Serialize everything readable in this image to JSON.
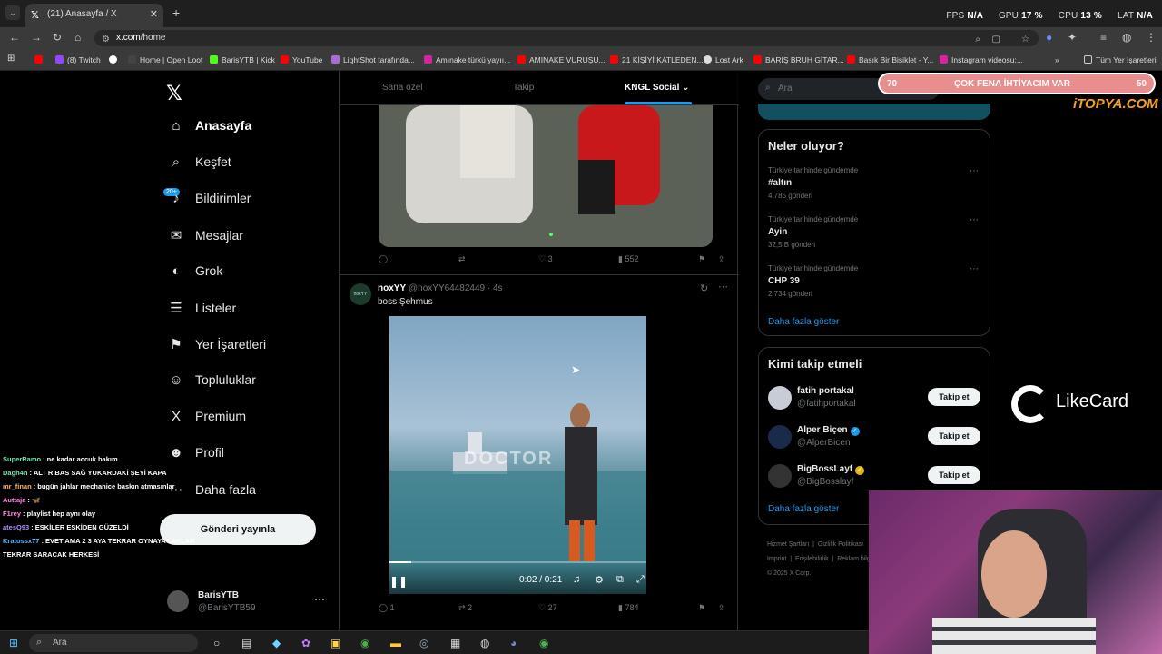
{
  "browser": {
    "tab_title": "(21) Anasayfa / X",
    "url_host": "x.com",
    "url_path": "/home",
    "bookmarks": [
      {
        "label": "(8) Twitch",
        "color": "#9146ff"
      },
      {
        "label": "Home | Open Loot",
        "color": "#444"
      },
      {
        "label": "BarisYTB | Kick",
        "color": "#53fc18"
      },
      {
        "label": "YouTube",
        "color": "#ff0000"
      },
      {
        "label": "LightShot tarafında...",
        "color": "#a86cd6"
      },
      {
        "label": "Amınake türkü yayıı...",
        "color": "#d6249f"
      },
      {
        "label": "AMINAKE VURUŞU...",
        "color": "#ff0000"
      },
      {
        "label": "21 KİŞİYİ KATLEDEN...",
        "color": "#ff0000"
      },
      {
        "label": "Lost Ark",
        "color": "#ddd"
      },
      {
        "label": "BARIŞ BRUH GİTAR...",
        "color": "#ff0000"
      },
      {
        "label": "Basık Bir Bisiklet - Y...",
        "color": "#ff0000"
      },
      {
        "label": "Instagram videosu:...",
        "color": "#d6249f"
      }
    ],
    "all_bookmarks": "Tüm Yer İşaretleri"
  },
  "perf": {
    "fps_label": "FPS",
    "fps_value": "N/A",
    "gpu_label": "GPU",
    "gpu_value": "17 %",
    "cpu_label": "CPU",
    "cpu_value": "13 %",
    "lat_label": "LAT",
    "lat_value": "N/A"
  },
  "sidebar": {
    "items": [
      {
        "label": "Anasayfa",
        "icon": "home-icon",
        "glyph": "⌂"
      },
      {
        "label": "Keşfet",
        "icon": "search-icon",
        "glyph": "⌕"
      },
      {
        "label": "Bildirimler",
        "icon": "bell-icon",
        "glyph": "♪"
      },
      {
        "label": "Mesajlar",
        "icon": "mail-icon",
        "glyph": "✉"
      },
      {
        "label": "Grok",
        "icon": "grok-icon",
        "glyph": "◐"
      },
      {
        "label": "Listeler",
        "icon": "list-icon",
        "glyph": "☰"
      },
      {
        "label": "Yer İşaretleri",
        "icon": "bookmark-icon",
        "glyph": "⚑"
      },
      {
        "label": "Topluluklar",
        "icon": "communities-icon",
        "glyph": "☺"
      },
      {
        "label": "Premium",
        "icon": "x-logo-icon",
        "glyph": "X"
      },
      {
        "label": "Profil",
        "icon": "profile-icon",
        "glyph": "☻"
      },
      {
        "label": "Daha fazla",
        "icon": "more-icon",
        "glyph": "⋯"
      }
    ],
    "notif_badge": "20+",
    "post_button": "Gönderi yayınla",
    "me_name": "BarisYTB",
    "me_handle": "@BarisYTB59"
  },
  "chat": [
    {
      "user": "SuperRamo",
      "color": "#7be3b0",
      "msg": ": ne kadar accuk bakım"
    },
    {
      "user": "Dagh4n",
      "color": "#7be3b0",
      "msg": ": ALT R BAS SAĞ YUKARDAKİ ŞEYİ KAPA"
    },
    {
      "user": "mr_finan",
      "color": "#ffb36b",
      "msg": ": bugün jahlar mechanice baskın atmasınlar"
    },
    {
      "user": "Auttaja",
      "color": "#ff8be0",
      "msg": ": 🦋"
    },
    {
      "user": "F1rey",
      "color": "#ff8be0",
      "msg": ": playlist hep aynı olay"
    },
    {
      "user": "atesQ93",
      "color": "#b28bff",
      "msg": ": ESKİLER ESKİDEN GÜZELDİ"
    },
    {
      "user": "Kratossx77",
      "color": "#5fb4ff",
      "msg": ": EVET AMA 2 3 AYA TEKRAR OYNAYACAKLAR TEKRAR SARACAK HERKESİ"
    }
  ],
  "timeline": {
    "tabs": [
      "Sana özel",
      "Takip",
      "KNGL Social"
    ],
    "post1": {
      "reply": "",
      "repost": "",
      "likes": "3",
      "views": "552"
    },
    "post2": {
      "avatar_text": "noxYY",
      "name": "noxYY",
      "handle": "@noxYY64482449 · 4s",
      "text": "boss Şehmus",
      "video_time": "0:02 / 0:21",
      "video_progress": 0.1,
      "replies": "1",
      "reposts": "2",
      "likes": "27",
      "views": "784"
    }
  },
  "right": {
    "search_placeholder": "Ara",
    "trending_title": "Neler oluyor?",
    "trends": [
      {
        "context": "Türkiye tarihinde gündemde",
        "name": "#altın",
        "count": "4.785 gönderi"
      },
      {
        "context": "Türkiye tarihinde gündemde",
        "name": "Ayin",
        "count": "32,5 B gönderi"
      },
      {
        "context": "Türkiye tarihinde gündemde",
        "name": "CHP 39",
        "count": "2.734 gönderi"
      }
    ],
    "show_more": "Daha fazla göster",
    "who_title": "Kimi takip etmeli",
    "who": [
      {
        "name": "fatih portakal",
        "handle": "@fatihportakal",
        "verified": ""
      },
      {
        "name": "Alper Biçen",
        "handle": "@AlperBicen",
        "verified": "blue"
      },
      {
        "name": "BigBossLayf",
        "handle": "@BigBosslayf",
        "verified": "gold"
      }
    ],
    "follow_label": "Takip et",
    "footer": [
      "Hizmet Şartları",
      "Gizlilik Politikası",
      "Imprint",
      "Erişilebilirlik",
      "Reklam bilgisi",
      "© 2025 X Corp."
    ]
  },
  "overlay": {
    "bar_left": "70",
    "bar_text": "ÇOK FENA İHTİYACIM VAR",
    "bar_right": "50",
    "itopya": "iTOPYA.COM",
    "likecard": "LikeCard",
    "video_watermark": "DOCTOR"
  },
  "taskbar": {
    "search_placeholder": "Ara"
  }
}
